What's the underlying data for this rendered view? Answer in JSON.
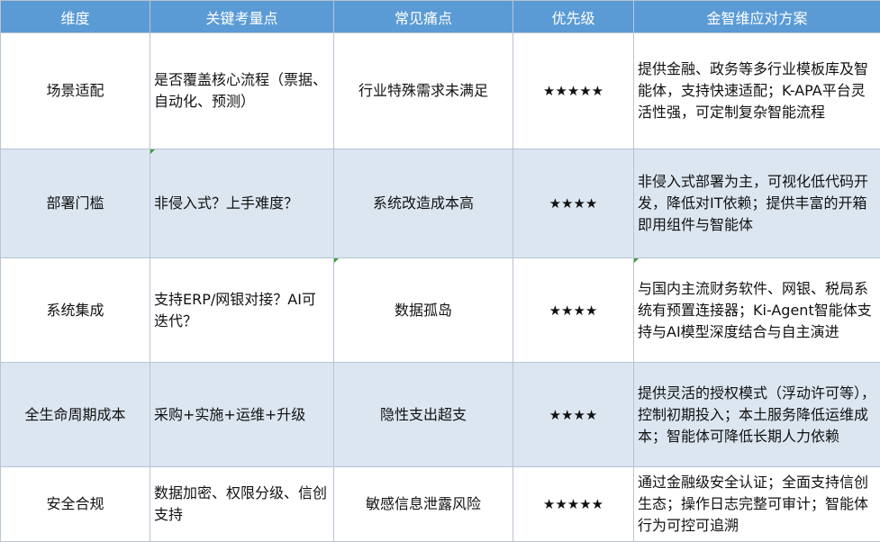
{
  "table": {
    "headers": [
      "维度",
      "关键考量点",
      "常见痛点",
      "优先级",
      "金智维应对方案"
    ],
    "rows": [
      {
        "dimension": "场景适配",
        "considerations": "是否覆盖核心流程（票据、自动化、预测）",
        "pain_point": "行业特殊需求未满足",
        "priority": "★★★★★",
        "solution": "提供金融、政务等多行业模板库及智能体，支持快速适配；K-APA平台灵活性强，可定制复杂智能流程"
      },
      {
        "dimension": "部署门槛",
        "considerations": "非侵入式？上手难度？",
        "pain_point": "系统改造成本高",
        "priority": "★★★★",
        "solution": "非侵入式部署为主，可视化低代码开发，降低对IT依赖；提供丰富的开箱即用组件与智能体"
      },
      {
        "dimension": "系统集成",
        "considerations": "支持ERP/网银对接？AI可迭代？",
        "pain_point": "数据孤岛",
        "priority": "★★★★",
        "solution": " 与国内主流财务软件、网银、税局系统有预置连接器；Ki-Agent智能体支持与AI模型深度结合与自主演进"
      },
      {
        "dimension": "全生命周期成本",
        "considerations": "采购+实施+运维+升级",
        "pain_point": "隐性支出超支",
        "priority": "★★★★",
        "solution": "提供灵活的授权模式（浮动许可等），控制初期投入；本土服务降低运维成本；智能体可降低长期人力依赖"
      },
      {
        "dimension": "安全合规",
        "considerations": "数据加密、权限分级、信创支持",
        "pain_point": "敏感信息泄露风险",
        "priority": "★★★★★",
        "solution": "通过金融级安全认证；全面支持信创生态；操作日志完整可审计；智能体行为可控可追溯"
      }
    ]
  }
}
